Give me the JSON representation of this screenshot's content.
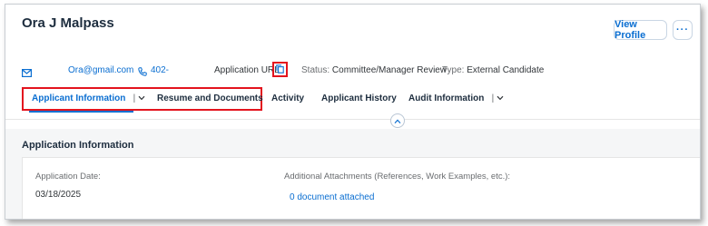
{
  "header": {
    "name": "Ora J Malpass",
    "view_profile": "View Profile",
    "more": "···"
  },
  "contact": {
    "email": "Ora@gmail.com",
    "phone": "402-",
    "application_url_label": "Application URL",
    "status_label": "Status:",
    "status_value": "Committee/Manager Review",
    "type_label": "Type:",
    "type_value": "External Candidate"
  },
  "tabs": [
    {
      "label": "Applicant Information",
      "active": true,
      "has_menu": true
    },
    {
      "label": "Resume and Documents",
      "active": false
    },
    {
      "label": "Activity",
      "active": false
    },
    {
      "label": "Applicant History",
      "active": false
    },
    {
      "label": "Audit Information",
      "active": false,
      "has_menu": true
    }
  ],
  "section": {
    "title": "Application Information",
    "application_date_label": "Application Date:",
    "application_date_value": "03/18/2025",
    "attachments_label": "Additional Attachments (References, Work Examples, etc.):",
    "attachments_link": "0 document attached"
  },
  "colors": {
    "accent": "#0a6ed1",
    "highlight": "#e3141e"
  }
}
